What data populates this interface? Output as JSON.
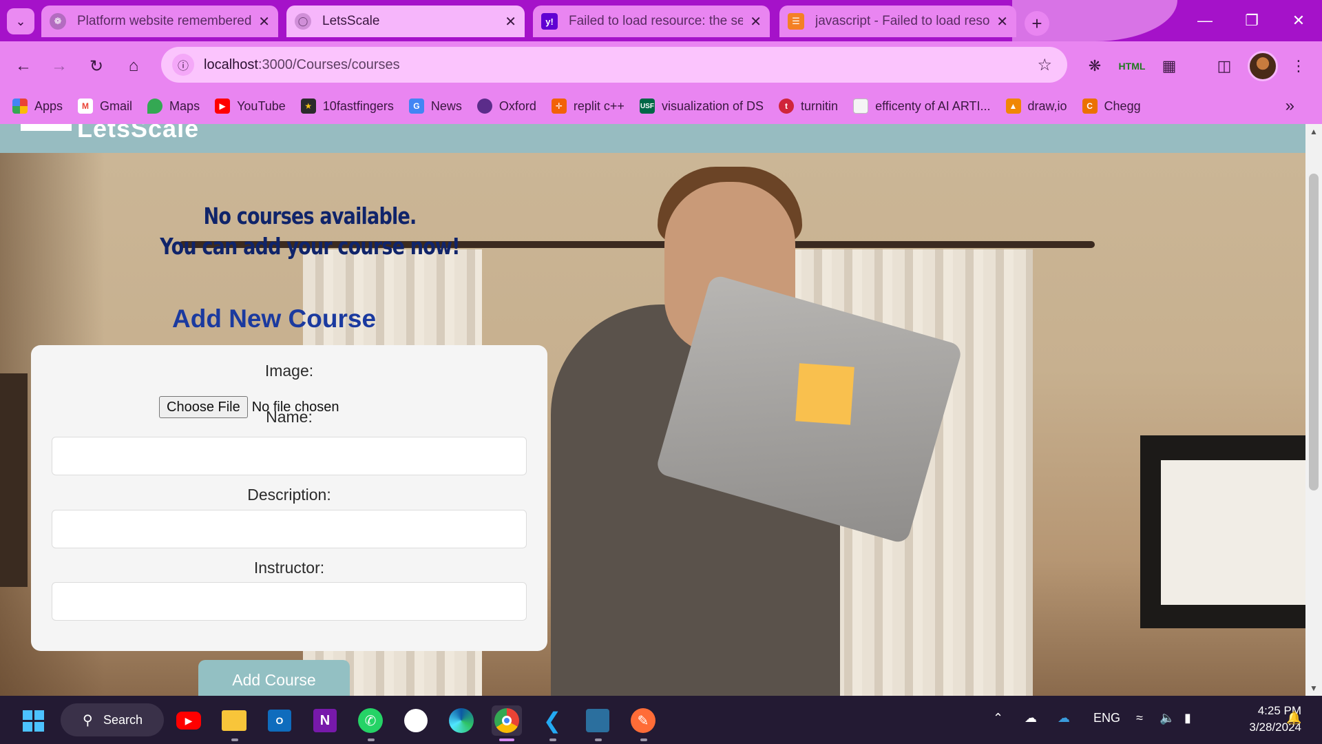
{
  "browser": {
    "tabs": [
      {
        "title": "Platform website remembered",
        "favicon": "chatgpt-icon",
        "active": false
      },
      {
        "title": "LetsScale",
        "favicon": "globe-icon",
        "active": true
      },
      {
        "title": "Failed to load resource: the serv",
        "favicon": "yahoo-icon",
        "active": false
      },
      {
        "title": "javascript - Failed to load resou",
        "favicon": "stackoverflow-icon",
        "active": false
      }
    ],
    "url_host": "localhost",
    "url_path": ":3000/Courses/courses",
    "bookmarks": [
      {
        "label": "Apps",
        "icon": "apps-grid-icon",
        "color": "#e44d26"
      },
      {
        "label": "Gmail",
        "icon": "gmail-icon",
        "color": "#ea4335"
      },
      {
        "label": "Maps",
        "icon": "maps-icon",
        "color": "#34a853"
      },
      {
        "label": "YouTube",
        "icon": "youtube-icon",
        "color": "#ff0000"
      },
      {
        "label": "10fastfingers",
        "icon": "10fastfingers-icon",
        "color": "#2b2b2b"
      },
      {
        "label": "News",
        "icon": "news-icon",
        "color": "#4285f4"
      },
      {
        "label": "Oxford",
        "icon": "oxford-icon",
        "color": "#5b2c8a"
      },
      {
        "label": "replit c++",
        "icon": "replit-icon",
        "color": "#f26207"
      },
      {
        "label": "visualization of DS",
        "icon": "usf-icon",
        "color": "#006747"
      },
      {
        "label": "turnitin",
        "icon": "turnitin-icon",
        "color": "#d0253a"
      },
      {
        "label": "efficenty of AI ARTI...",
        "icon": "document-icon",
        "color": "#dddddd"
      },
      {
        "label": "draw,io",
        "icon": "drawio-icon",
        "color": "#f08705"
      },
      {
        "label": "Chegg",
        "icon": "chegg-icon",
        "color": "#eb7100"
      }
    ]
  },
  "site": {
    "logo": "LetsScale",
    "empty_line1": "No courses available.",
    "empty_line2": "You can add your course now!",
    "form_title": "Add New Course",
    "image_label": "Image:",
    "choose_file": "Choose File",
    "no_file": "No file chosen",
    "name_label": "Name:",
    "description_label": "Description:",
    "instructor_label": "Instructor:",
    "submit": "Add Course"
  },
  "taskbar": {
    "search": "Search",
    "lang": "ENG",
    "time": "4:25 PM",
    "date": "3/28/2024"
  },
  "colors": {
    "chrome_frame": "#a512c9",
    "chrome_toolbar": "#e985f1",
    "site_header": "#97bcc1",
    "heading_navy": "#10246a",
    "form_title_blue": "#1b3a9f",
    "button_teal": "#93c0c3"
  }
}
